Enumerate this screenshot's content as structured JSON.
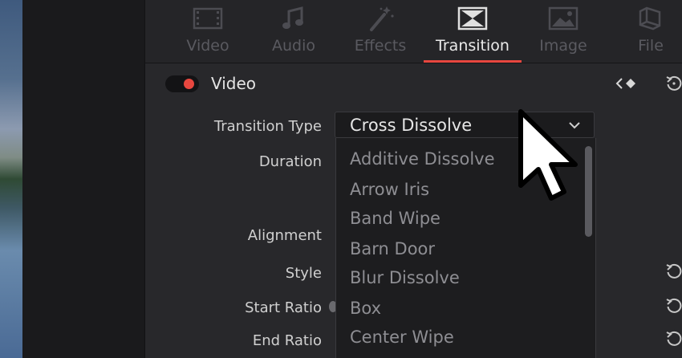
{
  "tabs": [
    {
      "label": "Video",
      "icon": "filmstrip-icon",
      "active": false
    },
    {
      "label": "Audio",
      "icon": "music-note-icon",
      "active": false
    },
    {
      "label": "Effects",
      "icon": "magic-wand-icon",
      "active": false
    },
    {
      "label": "Transition",
      "icon": "transition-icon",
      "active": true
    },
    {
      "label": "Image",
      "icon": "image-icon",
      "active": false
    },
    {
      "label": "File",
      "icon": "file-icon",
      "active": false
    }
  ],
  "section": {
    "title": "Video",
    "enabled": true
  },
  "fields": {
    "transition_type": "Transition Type",
    "duration": "Duration",
    "alignment": "Alignment",
    "style": "Style",
    "start_ratio": "Start Ratio",
    "end_ratio": "End Ratio"
  },
  "dropdown": {
    "selected": "Cross Dissolve",
    "options": [
      "Additive Dissolve",
      "Arrow Iris",
      "Band Wipe",
      "Barn Door",
      "Blur Dissolve",
      "Box",
      "Center Wipe"
    ]
  },
  "colors": {
    "accent": "#e8473f",
    "panel": "#28282b",
    "tab_inactive": "#5a5a60"
  }
}
